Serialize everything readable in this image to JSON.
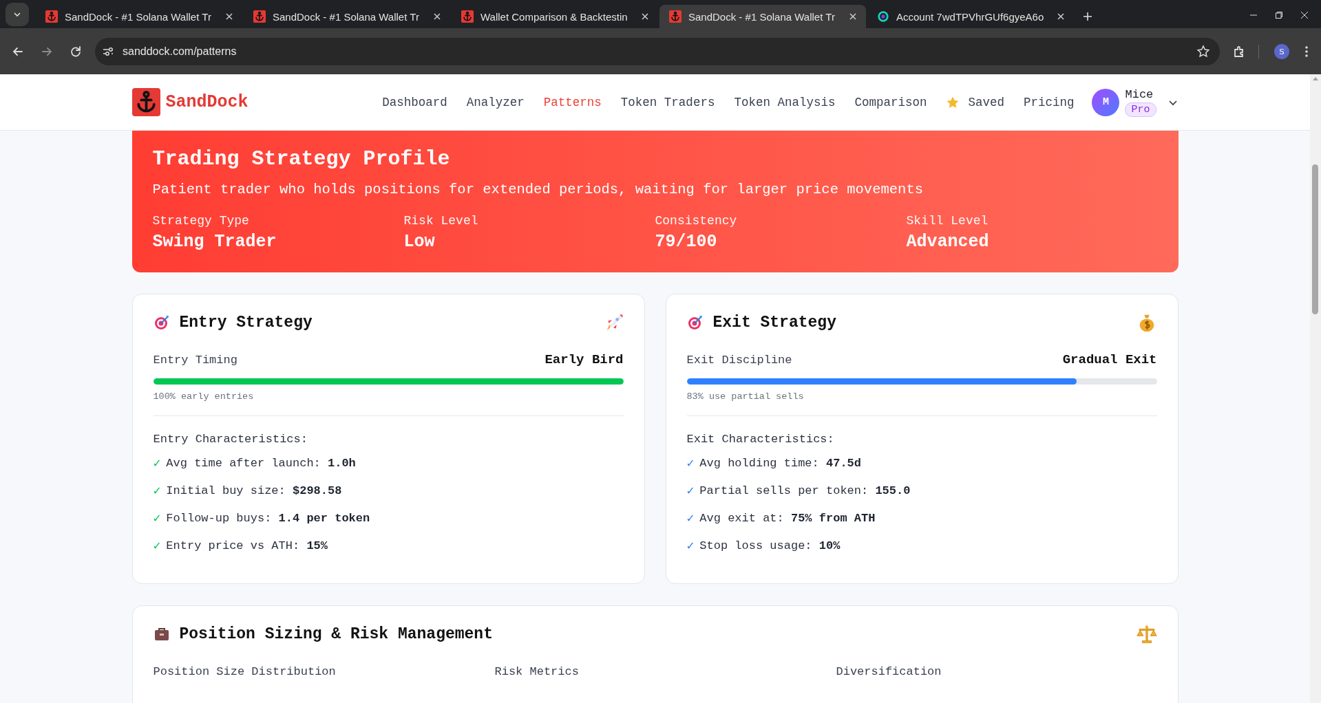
{
  "browser": {
    "tabs": [
      {
        "title": "SandDock - #1 Solana Wallet Tr",
        "kind": "anchor",
        "selected": false
      },
      {
        "title": "SandDock - #1 Solana Wallet Tr",
        "kind": "anchor",
        "selected": false
      },
      {
        "title": "Wallet Comparison & Backtestin",
        "kind": "anchor",
        "selected": false
      },
      {
        "title": "SandDock - #1 Solana Wallet Tr",
        "kind": "anchor",
        "selected": true
      },
      {
        "title": "Account 7wdTPVhrGUf6gyeA6o",
        "kind": "ring",
        "selected": false
      }
    ],
    "address": "sanddock.com/patterns",
    "profile_initial": "S"
  },
  "header": {
    "brand": "SandDock",
    "nav": [
      {
        "label": "Dashboard",
        "selected": false
      },
      {
        "label": "Analyzer",
        "selected": false
      },
      {
        "label": "Patterns",
        "selected": true
      },
      {
        "label": "Token Traders",
        "selected": false
      },
      {
        "label": "Token Analysis",
        "selected": false
      },
      {
        "label": "Comparison",
        "selected": false
      },
      {
        "label": "Saved",
        "selected": false,
        "kind": "starred"
      },
      {
        "label": "Pricing",
        "selected": false
      }
    ],
    "user": {
      "initial": "M",
      "name": "Mice",
      "plan": "Pro"
    }
  },
  "profile": {
    "title": "Trading Strategy Profile",
    "description": "Patient trader who holds positions for extended periods, waiting for larger price movements",
    "stats": [
      {
        "label": "Strategy Type",
        "value": "Swing Trader"
      },
      {
        "label": "Risk Level",
        "value": "Low"
      },
      {
        "label": "Consistency",
        "value": "79/100"
      },
      {
        "label": "Skill Level",
        "value": "Advanced"
      }
    ]
  },
  "strategies": [
    {
      "title": "Entry Strategy",
      "color": "#00c853",
      "metric_label": "Entry Timing",
      "metric_value": "Early Bird",
      "level": 1.0,
      "caption": "100% early entries",
      "list_title": "Entry Characteristics:",
      "items": [
        {
          "mark": "✓",
          "label": "Avg time after launch:",
          "value": "1.0h"
        },
        {
          "mark": "✓",
          "label": "Initial buy size:",
          "value": "$298.58"
        },
        {
          "mark": "✓",
          "label": "Follow-up buys:",
          "value": "1.4 per token"
        },
        {
          "mark": "✓",
          "label": "Entry price vs ATH:",
          "value": "15%"
        }
      ]
    },
    {
      "title": "Exit Strategy",
      "color": "#2f80ff",
      "metric_label": "Exit Discipline",
      "metric_value": "Gradual Exit",
      "level": 0.83,
      "caption": "83% use partial sells",
      "list_title": "Exit Characteristics:",
      "items": [
        {
          "mark": "✓",
          "label": "Avg holding time:",
          "value": "47.5d"
        },
        {
          "mark": "✓",
          "label": "Partial sells per token:",
          "value": "155.0"
        },
        {
          "mark": "✓",
          "label": "Avg exit at:",
          "value": "75% from ATH"
        },
        {
          "mark": "✓",
          "label": "Stop loss usage:",
          "value": "10%"
        }
      ]
    }
  ],
  "position": {
    "title": "Position Sizing & Risk Management",
    "columns": [
      "Position Size Distribution",
      "Risk Metrics",
      "Diversification"
    ]
  }
}
